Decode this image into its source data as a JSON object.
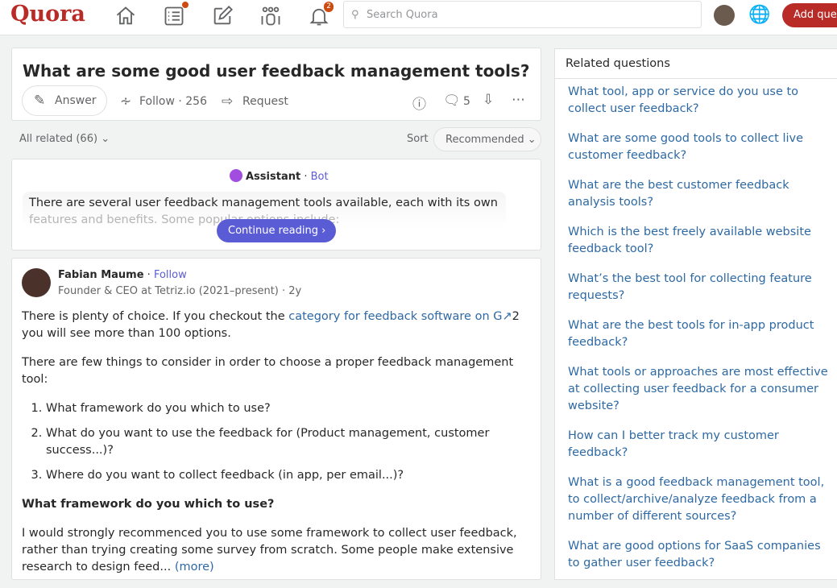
{
  "header": {
    "logo": "Quora",
    "search_placeholder": "Search Quora",
    "notif_count": "2",
    "add_question": "Add question"
  },
  "question": {
    "title": "What are some good user feedback management tools?",
    "answer": "Answer",
    "follow": "Follow · 256",
    "request": "Request",
    "comments": "5"
  },
  "filter": {
    "all_related": "All related (66)",
    "sort_label": "Sort",
    "sort_value": "Recommended"
  },
  "assistant": {
    "name": "Assistant",
    "sep": " · ",
    "bot": "Bot",
    "text1": "There are several user feedback management tools available, each with its own",
    "text2": "features and benefits. Some popular options include:",
    "continue": "Continue reading"
  },
  "answer": {
    "author": "Fabian Maume",
    "follow": "Follow",
    "credential": "Founder & CEO at Tetriz.io (2021–present) · 2y",
    "p1_a": "There is plenty of choice. If you checkout the ",
    "p1_link": "category for feedback software on G",
    "p1_b": "2 you will see more than 100 options.",
    "p2": "There are few things to consider in order to choose a proper feedback management tool:",
    "list": [
      "What framework do you which to use?",
      "What do you want to use the feedback for (Product management, customer success...)?",
      "Where do you want to collect feedback (in app, per email...)?"
    ],
    "heading": "What framework do you which to use?",
    "p3": "I would strongly recommenced you to use some framework to collect user feedback, rather than trying creating some survey from scratch. Some people make extensive research to design feed... ",
    "more": "(more)"
  },
  "related": {
    "title": "Related questions",
    "items": [
      "What tool, app or service do you use to collect user feedback?",
      "What are some good tools to collect live customer feedback?",
      "What are the best customer feedback analysis tools?",
      "Which is the best freely available website feedback tool?",
      "What’s the best tool for collecting feature requests?",
      "What are the best tools for in-app product feedback?",
      "What tools or approaches are most effective at collecting user feedback for a consumer website?",
      "How can I better track my customer feedback?",
      "What is a good feedback management tool, to collect/archive/analyze feedback from a number of different sources?",
      "What are good options for SaaS companies to gather user feedback?"
    ]
  }
}
